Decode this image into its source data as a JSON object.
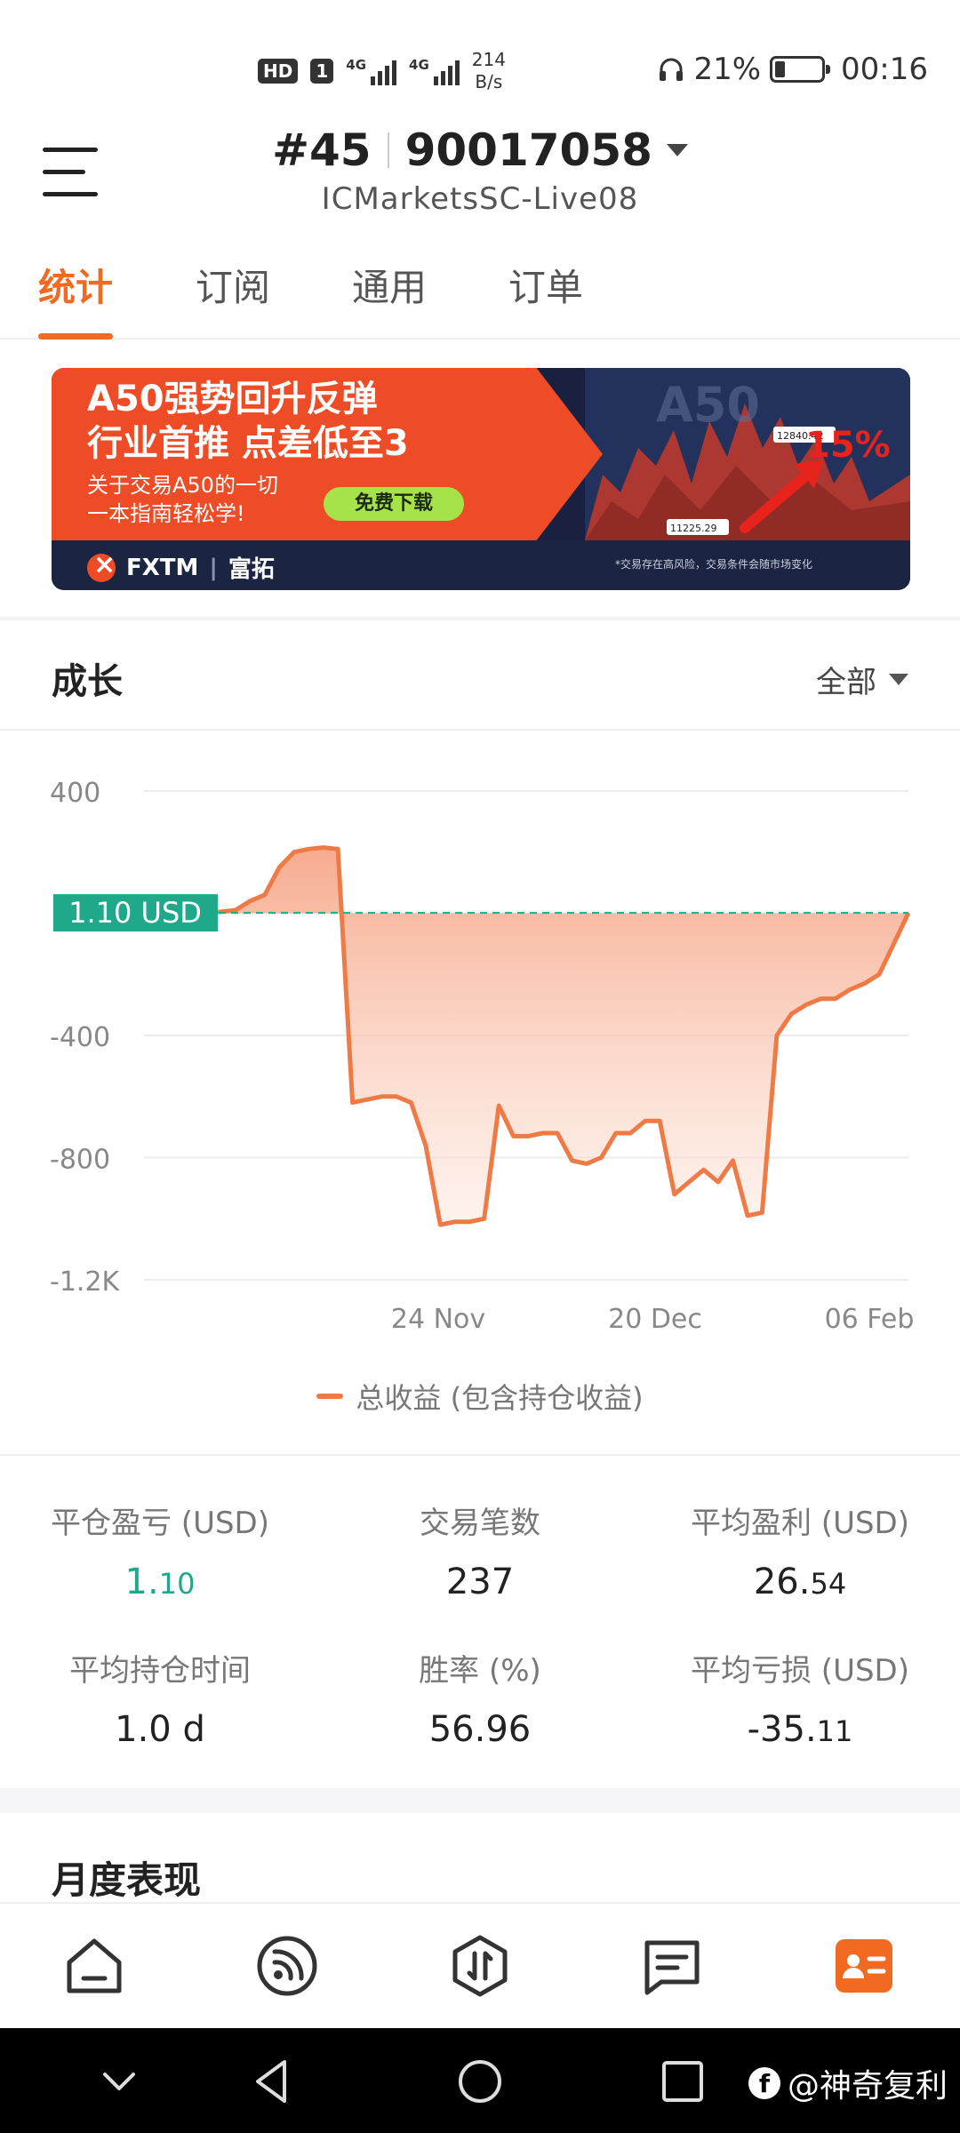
{
  "status_bar": {
    "hd": "HD",
    "sim": "1",
    "sig1": "4G",
    "sig2": "4G",
    "net_speed_value": "214",
    "net_speed_unit": "B/s",
    "battery_percent": "21%",
    "battery_level": 0.21,
    "time": "00:16"
  },
  "header": {
    "account_number": "#45",
    "account_id": "90017058",
    "server": "ICMarketsSC-Live08"
  },
  "tabs": [
    {
      "label": "统计",
      "active": true
    },
    {
      "label": "订阅",
      "active": false
    },
    {
      "label": "通用",
      "active": false
    },
    {
      "label": "订单",
      "active": false
    }
  ],
  "banner": {
    "headline_1": "A50强势回升反弹",
    "headline_2": "行业首推 点差低至3",
    "sub_1": "关于交易A50的一切",
    "sub_2": "一本指南轻松学!",
    "cta": "免费下载",
    "brand": "FXTM",
    "brand_cn": "富拓",
    "disclaimer": "*交易存在高风险，交易条件会随市场变化",
    "art_text": "A50",
    "price_high": "12840.42",
    "price_low": "11225.29",
    "percent": "15%"
  },
  "growth": {
    "title": "成长",
    "filter": "全部"
  },
  "chart_data": {
    "type": "area",
    "y_ticks": [
      "400",
      "",
      "-400",
      "-800",
      "-1.2K"
    ],
    "y_tick_values": [
      400,
      0,
      -400,
      -800,
      -1200
    ],
    "ylim": [
      -1200,
      400
    ],
    "x_ticks": [
      "24 Nov",
      "20 Dec",
      "06 Feb"
    ],
    "current_value_label": "1.10 USD",
    "current_value": 1.1,
    "grid": true,
    "series": [
      {
        "name": "总收益 (包含持仓收益)",
        "color": "#ef7a45",
        "values": [
          0,
          5,
          10,
          40,
          60,
          150,
          200,
          210,
          215,
          210,
          -620,
          -610,
          -600,
          -600,
          -620,
          -760,
          -1020,
          -1010,
          -1010,
          -1000,
          -630,
          -730,
          -730,
          -720,
          -720,
          -810,
          -820,
          -800,
          -720,
          -720,
          -680,
          -680,
          -920,
          -880,
          -840,
          -880,
          -810,
          -990,
          -980,
          -400,
          -330,
          -300,
          -280,
          -280,
          -250,
          -230,
          -200,
          -100,
          1.1
        ]
      }
    ]
  },
  "legend_label": "总收益 (包含持仓收益)",
  "stats": [
    {
      "label": "平仓盈亏 (USD)",
      "value_main": "1.",
      "value_small": "10",
      "positive": true
    },
    {
      "label": "交易笔数",
      "value_main": "237",
      "value_small": "",
      "positive": false
    },
    {
      "label": "平均盈利 (USD)",
      "value_main": "26.",
      "value_small": "54",
      "positive": false
    },
    {
      "label": "平均持仓时间",
      "value_main": "1.0 d",
      "value_small": "",
      "positive": false
    },
    {
      "label": "胜率 (%)",
      "value_main": "56.96",
      "value_small": "",
      "positive": false
    },
    {
      "label": "平均亏损 (USD)",
      "value_main": "-35.",
      "value_small": "11",
      "positive": false
    }
  ],
  "monthly": {
    "title": "月度表现"
  },
  "bottom_nav": [
    {
      "icon": "home-icon",
      "active": false
    },
    {
      "icon": "signal-feed-icon",
      "active": false
    },
    {
      "icon": "trade-icon",
      "active": false
    },
    {
      "icon": "messages-icon",
      "active": false
    },
    {
      "icon": "profile-card-icon",
      "active": true
    }
  ],
  "accent_color": "#f26a21",
  "positive_color": "#1fa98a",
  "watermark": "@神奇复利"
}
